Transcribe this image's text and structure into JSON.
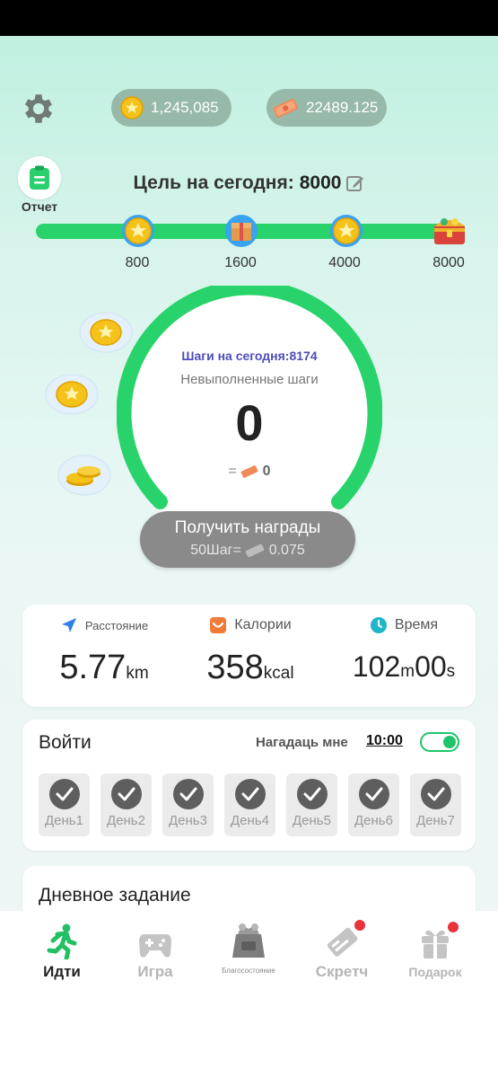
{
  "header": {
    "coins": "1,245,085",
    "cash": "22489.125",
    "report_label": "Отчет"
  },
  "goal": {
    "title": "Цель на сегодня:",
    "value": "8000"
  },
  "milestones": [
    "800",
    "1600",
    "4000",
    "8000"
  ],
  "gauge": {
    "steps_today": "Шаги на сегодня:8174",
    "remaining_label": "Невыполненные шаги",
    "remaining_value": "0",
    "equals_label": "=",
    "equals_value": "0"
  },
  "reward_button": {
    "label": "Получить награды",
    "rate": "50Шаг=",
    "rate_value": "0.075"
  },
  "stats": {
    "distance": {
      "label": "Расстояние",
      "value": "5.77",
      "unit": "km"
    },
    "calories": {
      "label": "Калории",
      "value": "358",
      "unit": "kcal"
    },
    "time": {
      "label": "Время",
      "value_min": "102",
      "unit_min": "m",
      "value_sec": "00",
      "unit_sec": "s"
    }
  },
  "signin": {
    "title": "Войти",
    "remind_label": "Нагадаць мне",
    "remind_time": "10:00",
    "remind_enabled": true,
    "days": [
      "День1",
      "День2",
      "День3",
      "День4",
      "День5",
      "День6",
      "День7"
    ]
  },
  "daily_task": {
    "title": "Дневное задание"
  },
  "nav": {
    "walk": "Идти",
    "game": "Игра",
    "welfare": "Благосостояние",
    "scratch": "Скретч",
    "gift": "Подарок"
  },
  "colors": {
    "accent_green": "#27d36a",
    "pill_bg": "#97b9a9",
    "coin_gold": "#f5c21a",
    "notification_red": "#e8323c"
  },
  "icons": [
    "gear-icon",
    "coin-icon",
    "cash-icon",
    "report-icon",
    "edit-icon",
    "gift-box-icon",
    "treasure-chest-icon",
    "location-arrow-icon",
    "calories-icon",
    "clock-icon",
    "check-icon",
    "runner-icon",
    "gamepad-icon",
    "welfare-bag-icon",
    "scratch-card-icon",
    "gift-icon"
  ]
}
